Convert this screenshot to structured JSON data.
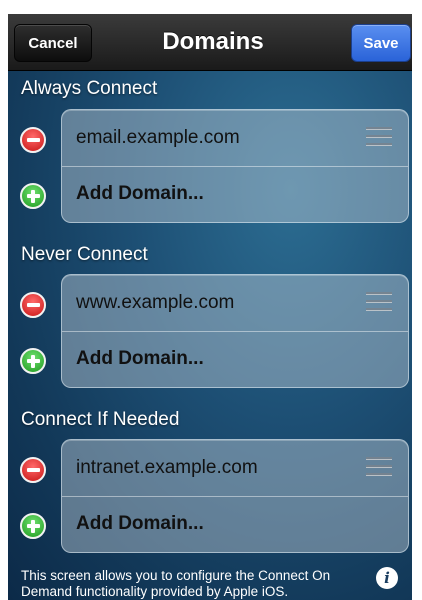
{
  "navbar": {
    "title": "Domains",
    "cancel_label": "Cancel",
    "save_label": "Save"
  },
  "sections": [
    {
      "header": "Always Connect",
      "domain": "email.example.com",
      "add_label": "Add Domain..."
    },
    {
      "header": "Never Connect",
      "domain": "www.example.com",
      "add_label": "Add Domain..."
    },
    {
      "header": "Connect If Needed",
      "domain": "intranet.example.com",
      "add_label": "Add Domain..."
    }
  ],
  "footer": {
    "text": "This screen allows you to configure the Connect On Demand functionality provided by Apple iOS."
  },
  "icons": {
    "remove": "minus-circle-icon",
    "add": "plus-circle-icon",
    "reorder": "reorder-grip-icon",
    "info": "info-icon"
  },
  "colors": {
    "save_button": "#3a74e4",
    "remove_button": "#d62020",
    "add_button": "#2aa52a",
    "background": "#1d4f74"
  }
}
